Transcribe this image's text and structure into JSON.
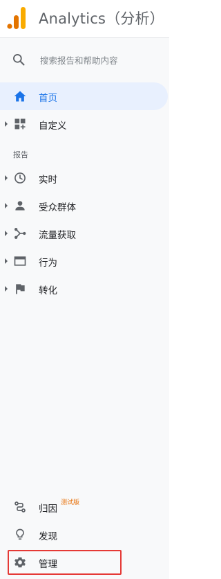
{
  "header": {
    "title": "Analytics（分析）",
    "logo_colors": [
      "#f9ab00",
      "#e37400",
      "#f9ab00"
    ]
  },
  "search": {
    "placeholder": "搜索报告和帮助内容",
    "icon": "search-icon"
  },
  "nav": {
    "home": {
      "label": "首页",
      "icon": "home-icon",
      "active": true
    },
    "customize": {
      "label": "自定义",
      "icon": "dashboard-add-icon"
    },
    "reports_section": "报告",
    "reports": [
      {
        "label": "实时",
        "icon": "clock-icon"
      },
      {
        "label": "受众群体",
        "icon": "person-icon"
      },
      {
        "label": "流量获取",
        "icon": "acquisition-icon"
      },
      {
        "label": "行为",
        "icon": "behavior-icon"
      },
      {
        "label": "转化",
        "icon": "flag-icon"
      }
    ],
    "bottom": [
      {
        "label": "归因",
        "badge": "测试版",
        "icon": "attribution-icon"
      },
      {
        "label": "发现",
        "icon": "lightbulb-icon"
      },
      {
        "label": "管理",
        "icon": "gear-icon",
        "highlighted": true
      }
    ]
  },
  "colors": {
    "accent": "#1a73e8",
    "active_bg": "#e8f0fe",
    "highlight_border": "#e53935",
    "badge": "#e8710a"
  }
}
